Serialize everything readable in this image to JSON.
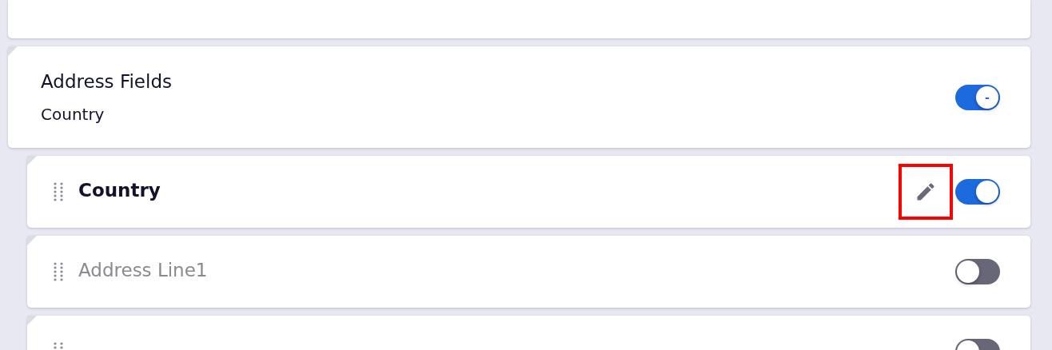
{
  "group": {
    "title": "Address Fields",
    "subtitle": "Country",
    "toggle": {
      "on": true,
      "thumb_label": "-"
    }
  },
  "fields": [
    {
      "label": "Country",
      "enabled": true,
      "editable": true,
      "highlighted": true
    },
    {
      "label": "Address Line1",
      "enabled": false
    },
    {
      "enabled": false
    }
  ]
}
